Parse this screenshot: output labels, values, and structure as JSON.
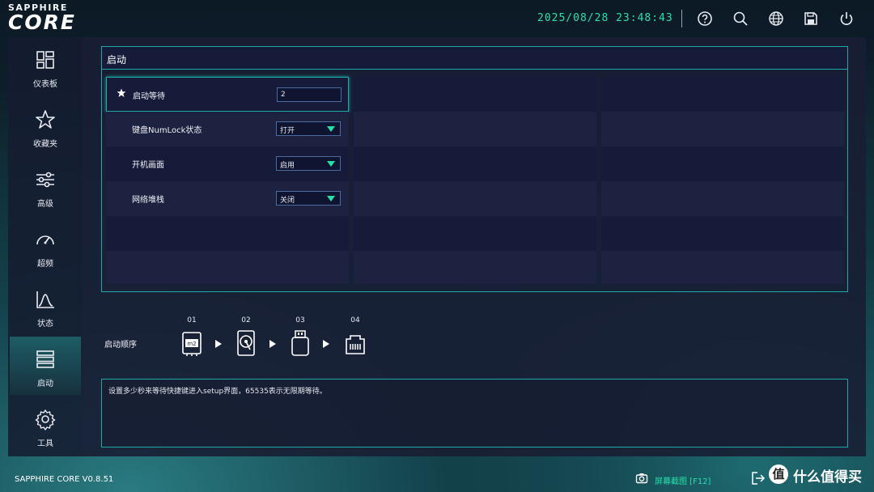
{
  "brand": {
    "top": "SAPPHIRE",
    "main": "CORE"
  },
  "header": {
    "datetime": "2025/08/28 23:48:43",
    "icons": [
      "help-icon",
      "search-icon",
      "globe-icon",
      "save-icon",
      "power-icon"
    ]
  },
  "sidebar": {
    "items": [
      {
        "label": "仪表板",
        "icon": "dashboard-icon"
      },
      {
        "label": "收藏夹",
        "icon": "star-icon"
      },
      {
        "label": "高级",
        "icon": "sliders-icon"
      },
      {
        "label": "超频",
        "icon": "gauge-icon"
      },
      {
        "label": "状态",
        "icon": "status-graph-icon"
      },
      {
        "label": "启动",
        "icon": "boot-stack-icon",
        "active": true
      },
      {
        "label": "工具",
        "icon": "gear-icon"
      }
    ]
  },
  "panel": {
    "title": "启动",
    "settings": [
      {
        "label": "启动等待",
        "value": "2",
        "type": "input",
        "starred": true
      },
      {
        "label": "键盘NumLock状态",
        "value": "打开",
        "type": "select"
      },
      {
        "label": "开机画面",
        "value": "启用",
        "type": "select"
      },
      {
        "label": "网络堆栈",
        "value": "关闭",
        "type": "select"
      }
    ]
  },
  "boot_order": {
    "label": "启动顺序",
    "devices": [
      {
        "num": "01",
        "icon": "m2-drive-icon"
      },
      {
        "num": "02",
        "icon": "hard-disk-icon"
      },
      {
        "num": "03",
        "icon": "usb-drive-icon"
      },
      {
        "num": "04",
        "icon": "network-port-icon"
      }
    ]
  },
  "help": {
    "text": "设置多少秒来等待快捷键进入setup界面，65535表示无限期等待。"
  },
  "footer": {
    "version": "SAPPHIRE CORE V0.8.51",
    "screenshot": "屏幕截图 [F12]"
  },
  "watermark": {
    "logo": "值",
    "text": "什么值得买"
  },
  "colors": {
    "accent": "#26e0a8",
    "border": "#1ea9a6",
    "panel": "#171b3a"
  }
}
